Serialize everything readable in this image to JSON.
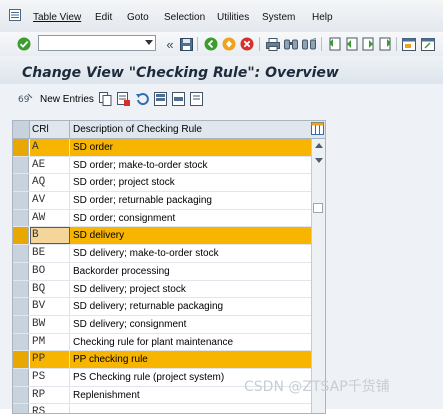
{
  "menu": {
    "icon": "menu-icon",
    "items": [
      "Table View",
      "Edit",
      "Goto",
      "Selection",
      "Utilities",
      "System",
      "Help"
    ]
  },
  "toolbar": {
    "command_field": "",
    "icons": [
      "enter-icon",
      "collapse-icon",
      "save-icon",
      "back-icon",
      "exit-icon",
      "cancel-icon",
      "print-icon",
      "find-icon",
      "find-next-icon",
      "first-page-icon",
      "previous-page-icon",
      "next-page-icon",
      "last-page-icon",
      "new-session-icon",
      "shortcut-icon",
      "help-icon"
    ]
  },
  "title": "Change View \"Checking Rule\": Overview",
  "app_toolbar": {
    "new_entries_label": "New Entries",
    "icons": [
      "copy-as-icon",
      "delete-icon",
      "undo-change-icon",
      "select-all-icon",
      "select-block-icon",
      "deselect-all-icon"
    ]
  },
  "table": {
    "columns": [
      "CRl",
      "Description of Checking Rule"
    ],
    "rows": [
      {
        "code": "A",
        "desc": "SD order",
        "highlight": true
      },
      {
        "code": "AE",
        "desc": "SD order; make-to-order stock"
      },
      {
        "code": "AQ",
        "desc": "SD order; project stock"
      },
      {
        "code": "AV",
        "desc": "SD order; returnable packaging"
      },
      {
        "code": "AW",
        "desc": "SD order; consignment"
      },
      {
        "code": "B",
        "desc": "SD delivery",
        "highlight": true,
        "cursor": true
      },
      {
        "code": "BE",
        "desc": "SD delivery; make-to-order stock"
      },
      {
        "code": "BO",
        "desc": "Backorder processing"
      },
      {
        "code": "BQ",
        "desc": "SD delivery; project stock"
      },
      {
        "code": "BV",
        "desc": "SD delivery; returnable packaging"
      },
      {
        "code": "BW",
        "desc": "SD delivery; consignment"
      },
      {
        "code": "PM",
        "desc": "Checking rule for plant maintenance"
      },
      {
        "code": "PP",
        "desc": "PP checking rule",
        "highlight": true
      },
      {
        "code": "PS",
        "desc": "PS Checking rule (project system)"
      },
      {
        "code": "RP",
        "desc": "Replenishment"
      },
      {
        "code": "RS",
        "desc": ""
      }
    ]
  },
  "watermark": "CSDN @ZTSAP千货铺",
  "colors": {
    "highlight": "#f7b500",
    "title": "#1c2a3a"
  }
}
